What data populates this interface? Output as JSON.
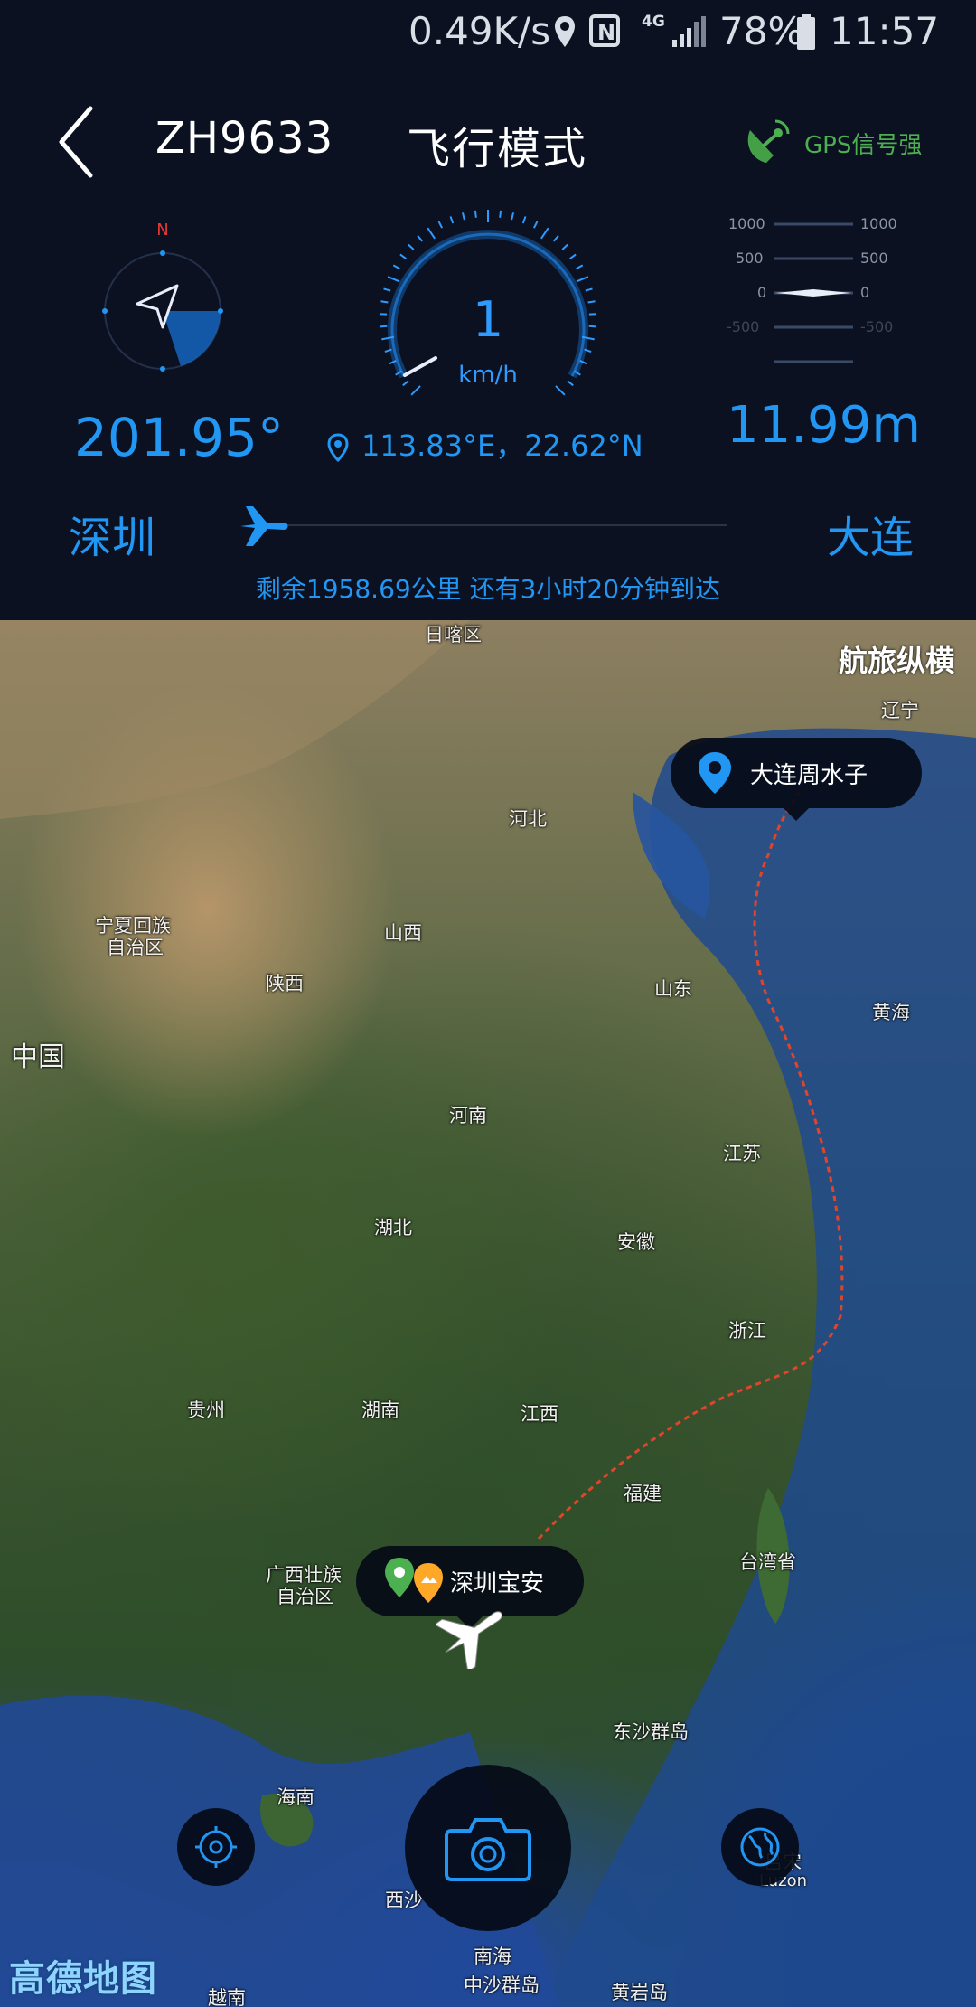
{
  "status_bar": {
    "net_speed": "0.49K/s",
    "network": "4G",
    "battery": "78%",
    "time": "11:57"
  },
  "header": {
    "flight_number": "ZH9633",
    "mode_title": "飞行模式",
    "gps_status": "GPS信号强"
  },
  "compass": {
    "north_label": "N",
    "heading": "201.95°"
  },
  "speedometer": {
    "value": "1",
    "unit": "km/h"
  },
  "position": {
    "coordinates": "113.83°E，22.62°N"
  },
  "altimeter": {
    "ticks": [
      "1000",
      "500",
      "0",
      "-500"
    ],
    "altitude": "11.99m"
  },
  "route": {
    "from": "深圳",
    "to": "大连",
    "remaining": "剩余1958.69公里  还有3小时20分钟到达",
    "progress_fraction": 0.02
  },
  "map": {
    "brand": "航旅纵横",
    "provider": "高德地图",
    "destination_marker": "大连周水子",
    "origin_marker": "深圳宝安",
    "labels": {
      "lbl_0": "日喀区",
      "lbl_1": "辽宁",
      "lbl_2": "河北",
      "lbl_3": "宁夏回族",
      "lbl_4": "自治区",
      "lbl_5": "山西",
      "lbl_6": "陕西",
      "lbl_7": "山东",
      "lbl_8": "黄海",
      "lbl_9": "中国",
      "lbl_10": "河南",
      "lbl_11": "江苏",
      "lbl_12": "湖北",
      "lbl_13": "安徽",
      "lbl_14": "浙江",
      "lbl_15": "贵州",
      "lbl_16": "湖南",
      "lbl_17": "江西",
      "lbl_18": "福建",
      "lbl_19": "广西壮族",
      "lbl_20": "自治区",
      "lbl_21": "台湾省",
      "lbl_22": "东沙群岛",
      "lbl_23": "海南",
      "lbl_24": "西沙",
      "lbl_25": "南海",
      "lbl_26": "中沙群岛",
      "lbl_27": "黄岩岛",
      "lbl_28": "吕宋",
      "lbl_29": "Luzon",
      "lbl_30": "越南"
    }
  },
  "colors": {
    "accent": "#2196f3",
    "gps_green": "#4caf50",
    "background": "#0b1120",
    "route_dash": "#e0452b"
  },
  "icons": [
    "back-icon",
    "location-pin-icon",
    "nfc-icon",
    "signal-icon",
    "battery-icon",
    "gps-dish-icon",
    "plane-icon",
    "locate-icon",
    "camera-icon",
    "globe-icon"
  ]
}
